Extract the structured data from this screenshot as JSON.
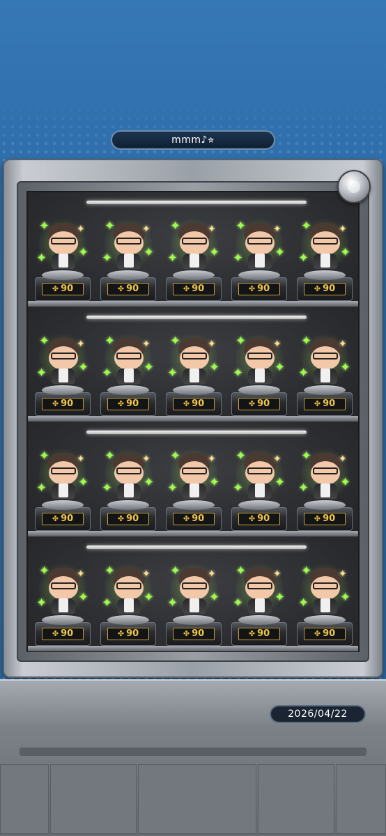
{
  "header": {
    "player_name": "mmm♪⭐︎"
  },
  "footer": {
    "date": "2026/04/22"
  },
  "shelves": [
    {
      "figures": [
        {
          "level": "90"
        },
        {
          "level": "90"
        },
        {
          "level": "90"
        },
        {
          "level": "90"
        },
        {
          "level": "90"
        }
      ]
    },
    {
      "figures": [
        {
          "level": "90"
        },
        {
          "level": "90"
        },
        {
          "level": "90"
        },
        {
          "level": "90"
        },
        {
          "level": "90"
        }
      ]
    },
    {
      "figures": [
        {
          "level": "90"
        },
        {
          "level": "90"
        },
        {
          "level": "90"
        },
        {
          "level": "90"
        },
        {
          "level": "90"
        }
      ]
    },
    {
      "figures": [
        {
          "level": "90"
        },
        {
          "level": "90"
        },
        {
          "level": "90"
        },
        {
          "level": "90"
        },
        {
          "level": "90"
        }
      ]
    }
  ],
  "icons": {
    "level": "clover-icon",
    "cabinet_badge": "cabinet-badge-icon"
  },
  "colors": {
    "background": "#2f6fae",
    "level_text": "#f0c64a",
    "sparkle": "#9bff4a"
  }
}
